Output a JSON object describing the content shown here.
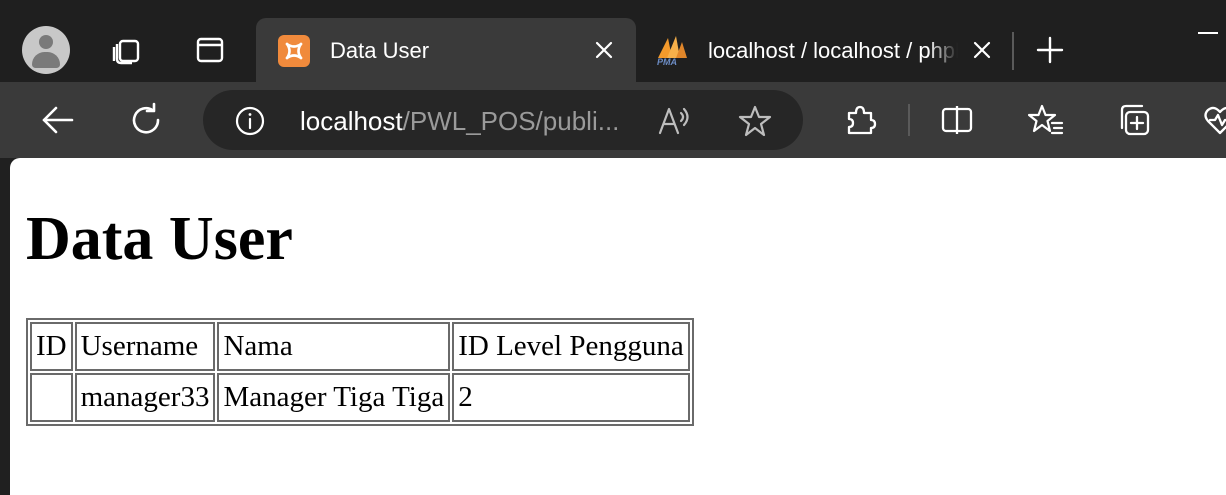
{
  "window": {
    "tabs": [
      {
        "title": "Data User",
        "icon": "xampp-icon",
        "active": true
      },
      {
        "title": "localhost / localhost / phpMyAdmin",
        "icon": "phpmyadmin-icon",
        "active": false
      }
    ]
  },
  "toolbar": {
    "url_host": "localhost",
    "url_path": "/PWL_POS/publi..."
  },
  "page": {
    "heading": "Data User",
    "table": {
      "headers": [
        "ID",
        "Username",
        "Nama",
        "ID Level Pengguna"
      ],
      "rows": [
        [
          "",
          "manager33",
          "Manager Tiga Tiga",
          "2"
        ]
      ]
    }
  },
  "colors": {
    "tabstrip_bg": "#1f1f1f",
    "toolbar_bg": "#3a3a3a",
    "omnibox_bg": "#262626",
    "xampp_orange": "#f08a3c"
  }
}
